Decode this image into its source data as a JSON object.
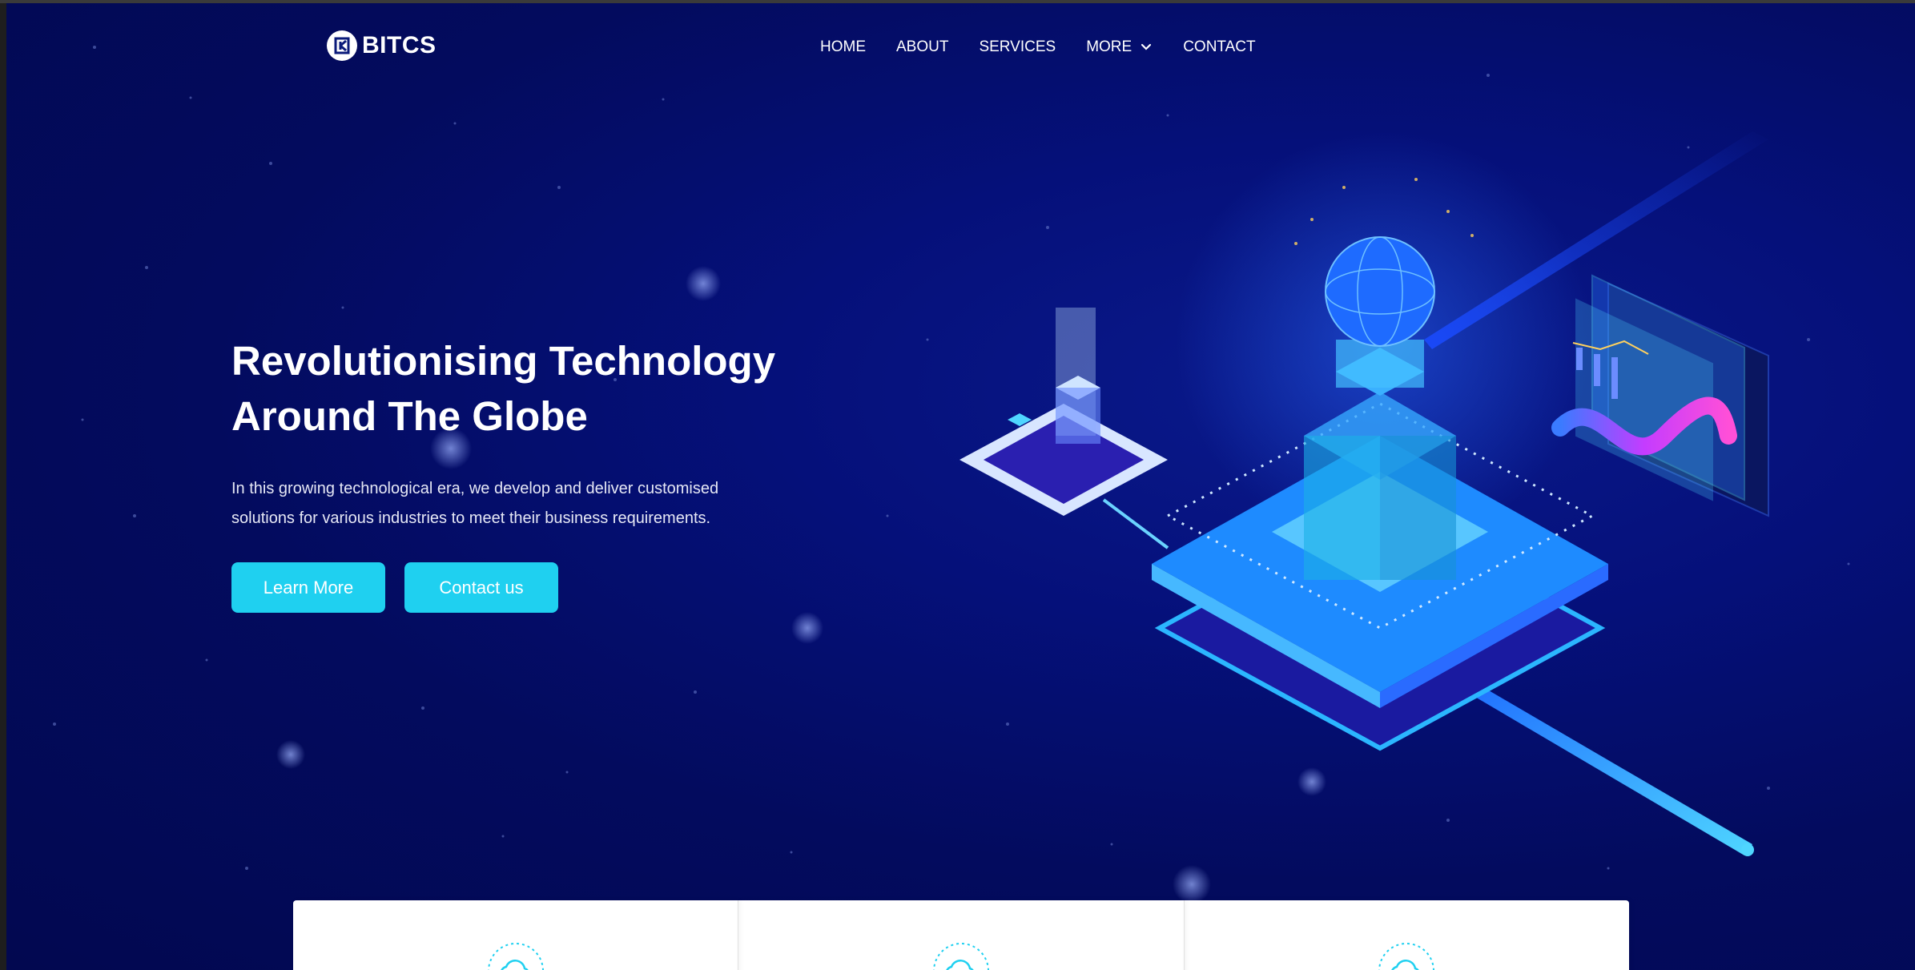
{
  "header": {
    "logo_text": "BITCS",
    "nav": [
      {
        "label": "HOME"
      },
      {
        "label": "ABOUT"
      },
      {
        "label": "SERVICES"
      },
      {
        "label": "MORE"
      },
      {
        "label": "CONTACT"
      }
    ]
  },
  "hero": {
    "title_line1": "Revolutionising Technology",
    "title_line2": "Around The Globe",
    "desc_line1": "In this growing technological era, we develop and deliver customised",
    "desc_line2": "solutions for various industries to meet their business requirements.",
    "learn_more_label": "Learn More",
    "contact_label": "Contact us"
  },
  "colors": {
    "background": "#030b5e",
    "accent": "#1fd0f0",
    "text": "#ffffff"
  },
  "icons": {
    "logo": "bitcs-logo-icon",
    "more_dropdown": "chevron-down-icon",
    "cards": "cloud-icon"
  },
  "cards": [
    {
      "icon": "cloud-icon"
    },
    {
      "icon": "cloud-icon"
    },
    {
      "icon": "cloud-icon"
    }
  ]
}
